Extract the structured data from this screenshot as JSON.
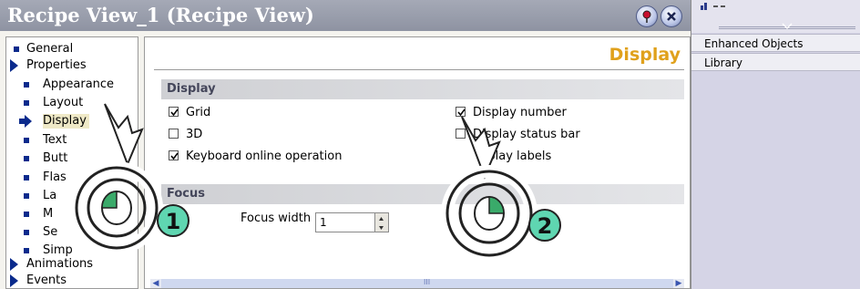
{
  "window": {
    "title": "Recipe View_1 (Recipe View)"
  },
  "tree": {
    "items": [
      {
        "label": "General",
        "level": 0,
        "marker": "square"
      },
      {
        "label": "Properties",
        "level": 0,
        "marker": "triangle"
      },
      {
        "label": "Appearance",
        "level": 1,
        "marker": "square"
      },
      {
        "label": "Layout",
        "level": 1,
        "marker": "square"
      },
      {
        "label": "Display",
        "level": 1,
        "marker": "arrow",
        "selected": true
      },
      {
        "label": "Text",
        "level": 1,
        "marker": "square"
      },
      {
        "label": "Butt",
        "level": 1,
        "marker": "square"
      },
      {
        "label": "Flas",
        "level": 1,
        "marker": "square"
      },
      {
        "label": "La",
        "level": 1,
        "marker": "square"
      },
      {
        "label": "M",
        "level": 1,
        "marker": "square"
      },
      {
        "label": "Se",
        "level": 1,
        "marker": "square"
      },
      {
        "label": "Simp",
        "level": 1,
        "marker": "square"
      },
      {
        "label": "Animations",
        "level": 0,
        "marker": "triangle"
      },
      {
        "label": "Events",
        "level": 0,
        "marker": "triangle"
      }
    ]
  },
  "content": {
    "heading": "Display",
    "display_section": {
      "title": "Display",
      "options": [
        {
          "label": "Grid",
          "checked": true
        },
        {
          "label": "3D",
          "checked": false
        },
        {
          "label": "Keyboard online operation",
          "checked": true
        },
        {
          "label": "Display number",
          "checked": true
        },
        {
          "label": "Display status bar",
          "checked": false
        },
        {
          "label": "isplay labels",
          "checked": false
        }
      ]
    },
    "focus_section": {
      "title": "Focus",
      "focus_width_label": "Focus width",
      "focus_width_value": "1"
    },
    "scroll_thumb": "III"
  },
  "right_panel": {
    "items": [
      "Enhanced Objects",
      "Library"
    ]
  },
  "badges": [
    "1",
    "2"
  ]
}
